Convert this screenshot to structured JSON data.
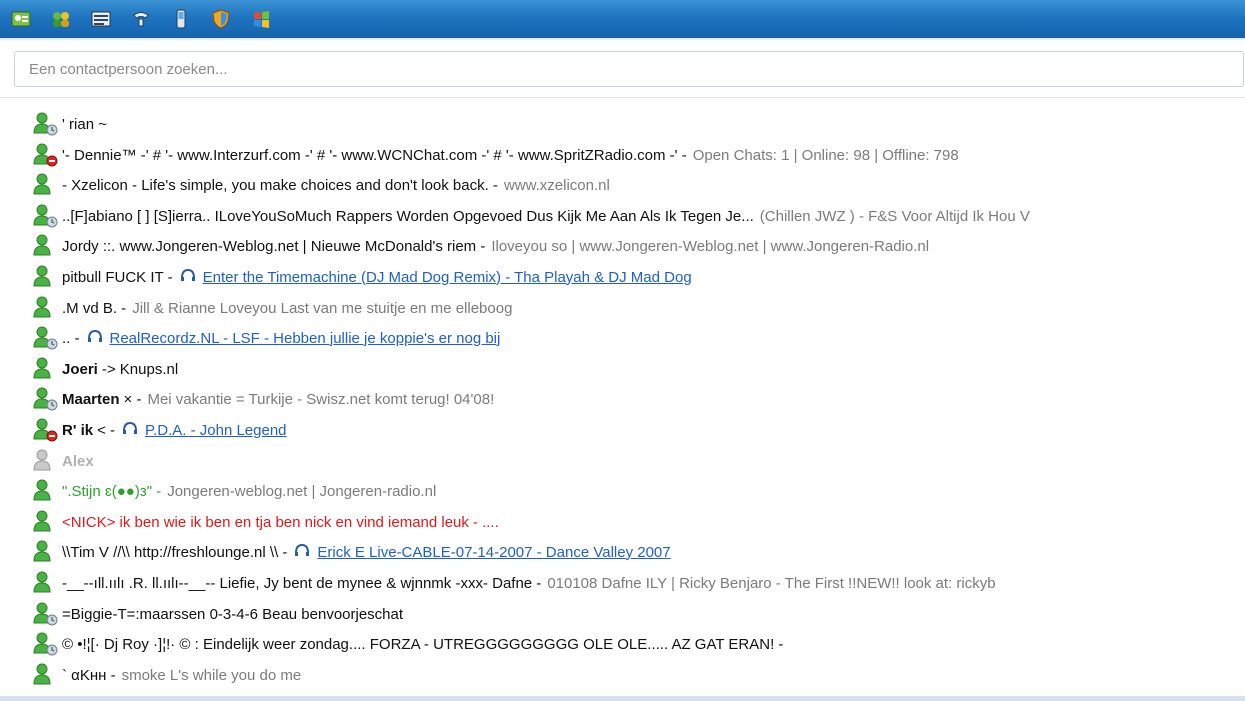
{
  "toolbar": {
    "buttons": [
      {
        "name": "contact-card-icon"
      },
      {
        "name": "add-contact-icon"
      },
      {
        "name": "group-list-icon"
      },
      {
        "name": "call-icon"
      },
      {
        "name": "mobile-device-icon"
      },
      {
        "name": "shield-icon"
      },
      {
        "name": "windows-flag-icon"
      }
    ]
  },
  "search": {
    "placeholder": "Een contactpersoon zoeken..."
  },
  "contacts": [
    {
      "status": "away",
      "name": "' rian ~",
      "message": ""
    },
    {
      "status": "busy",
      "name": "'- Dennie™ -' # '- www.Interzurf.com -' # '- www.WCNChat.com -' # '- www.SpritZRadio.com -' -",
      "message": "Open Chats: 1 | Online: 98 | Offline: 798"
    },
    {
      "status": "online",
      "name": "- Xzelicon -      Life's simple, you make choices and don't look back. -",
      "message": "www.xzelicon.nl"
    },
    {
      "status": "away",
      "name": "..[F]abiano [ ] [S]ierra..   ILoveYouSoMuch   Rappers Worden Opgevoed Dus Kijk Me Aan Als Ik Tegen Je...",
      "message": "(Chillen JWZ ) - F&S Voor Altijd  Ik Hou V"
    },
    {
      "status": "online",
      "name": "Jordy   ::. www.Jongeren-Weblog.net | Nieuwe McDonald's riem   -",
      "message": "Iloveyou so   | www.Jongeren-Weblog.net | www.Jongeren-Radio.nl"
    },
    {
      "status": "online",
      "name": "pitbull  FUCK IT   -",
      "message": "",
      "link": "Enter the Timemachine (DJ Mad Dog Remix) - Tha Playah & DJ Mad Dog"
    },
    {
      "status": "online",
      "name": ".M vd B.  -",
      "message": "Jill & Rianne Loveyou       Last van me stuitje en me elleboog"
    },
    {
      "status": "away",
      "name": ".. -",
      "message": "",
      "link": "RealRecordz.NL - LSF - Hebben jullie je koppie's er nog bij"
    },
    {
      "status": "online",
      "name": "Joeri",
      "name_extra": "-> Knups.nl",
      "message": ""
    },
    {
      "status": "away",
      "name": "Maarten",
      "name_extra": "× -",
      "message": "Mei vakantie = Turkije    - Swisz.net komt terug! 04'08!"
    },
    {
      "status": "busy",
      "name": "R' ik",
      "name_extra": "< -",
      "message": "",
      "link": "P.D.A. - John Legend"
    },
    {
      "status": "offline",
      "name": "Alex",
      "message": ""
    },
    {
      "status": "online",
      "name": "\".Stijn ɛ(●●)з\" -",
      "message": "Jongeren-weblog.net | Jongeren-radio.nl"
    },
    {
      "status": "online",
      "name": "<NICK> ik ben wie ik ben en tja ben nick en vind iemand leuk",
      "name_extra": "- ....",
      "message": ""
    },
    {
      "status": "online",
      "name": "\\\\Tim V //\\\\ http://freshlounge.nl \\\\ -",
      "message": "",
      "link": "Erick E Live-CABLE-07-14-2007 - Dance Valley 2007"
    },
    {
      "status": "online",
      "name": "-__--ıll.ıılı      .R.      ll.ıılı--__--     Liefie, Jy bent de mynee & wjnnmk   -xxx- Dafne -",
      "message": "010108  Dafne ILY | Ricky Benjaro - The First !!NEW!!   look at: rickyb"
    },
    {
      "status": "away",
      "name": "=Biggie-T=:maarssen 0-3-4-6 Beau benvoorjeschat",
      "message": ""
    },
    {
      "status": "away",
      "name": "©    •!¦[·  Dj Roy  ·]¦!·       © : Eindelijk weer zondag.... FORZA - UTREGGGGGGGGG OLE OLE..... AZ GAT ERAN!     -",
      "message": ""
    },
    {
      "status": "online",
      "name": "` αKнн -",
      "message": "smoke L's while you do me"
    }
  ]
}
